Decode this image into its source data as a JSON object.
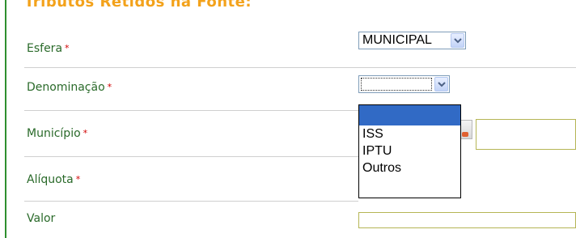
{
  "section": {
    "title": "Tributos Retidos na Fonte:"
  },
  "form": {
    "required_marker": "*",
    "esfera": {
      "label": "Esfera",
      "value": "MUNICIPAL"
    },
    "denominacao": {
      "label": "Denominação",
      "value": "",
      "options": [
        "",
        "ISS",
        "IPTU",
        "Outros"
      ],
      "selected_index": 0
    },
    "municipio": {
      "label": "Município"
    },
    "aliquota": {
      "label": "Alíquota"
    },
    "valor": {
      "label": "Valor"
    }
  },
  "colors": {
    "frame_border": "#2f8f2f",
    "label_text": "#2a6a2a",
    "required": "#d00000",
    "title": "#f3a21b",
    "selection": "#316ac5",
    "input_border": "#b5b555"
  },
  "icons": {
    "select_arrow": "chevron-down-icon",
    "lookup": "search-lookup-icon"
  }
}
